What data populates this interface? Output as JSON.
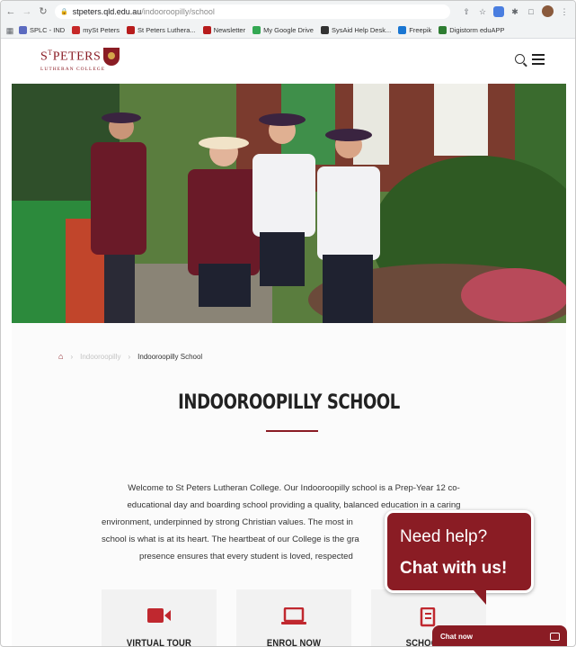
{
  "browser": {
    "url_host": "stpeters.qld.edu.au",
    "url_path": "/indooroopilly/school",
    "bookmarks": [
      {
        "label": "SPLC - IND",
        "color": "#5c6bc0"
      },
      {
        "label": "mySt Peters",
        "color": "#c62828"
      },
      {
        "label": "St Peters Luthera...",
        "color": "#b71c1c"
      },
      {
        "label": "Newsletter",
        "color": "#b71c1c"
      },
      {
        "label": "My Google Drive",
        "color": "#34a853"
      },
      {
        "label": "SysAid Help Desk...",
        "color": "#333333"
      },
      {
        "label": "Freepik",
        "color": "#1976d2"
      },
      {
        "label": "Digistorm eduAPP",
        "color": "#2e7d32"
      }
    ]
  },
  "site": {
    "logo_text": "STPETERS",
    "logo_sup": "T",
    "logo_sub": "LUTHERAN COLLEGE",
    "icons": {
      "search": "search-icon",
      "menu": "hamburger-menu-icon"
    }
  },
  "breadcrumb": {
    "home_icon": "home-icon",
    "middle": "Indooroopilly",
    "current": "Indooroopilly School"
  },
  "page": {
    "title": "INDOOROOPILLY SCHOOL",
    "intro_lines": [
      "Welcome to St Peters Lutheran College. Our Indooroopilly school is a Prep-Year 12 co-",
      "educational day and boarding school providing a quality, balanced education in a caring",
      "environment, underpinned by strong Christian values. The most in",
      "school is what is at its heart. The heartbeat of our College is the gra",
      "presence ensures that every student is loved, respected"
    ]
  },
  "cards": [
    {
      "label": "VIRTUAL TOUR",
      "icon": "video-camera-icon"
    },
    {
      "label": "ENROL NOW",
      "icon": "laptop-icon"
    },
    {
      "label": "SCHOOL P",
      "icon": "document-icon"
    }
  ],
  "chat": {
    "bubble_line1": "Need help?",
    "bubble_line2": "Chat with us!",
    "bar_label": "Chat now",
    "accent": "#8a1c24"
  },
  "colors": {
    "brand": "#8a1c24"
  }
}
